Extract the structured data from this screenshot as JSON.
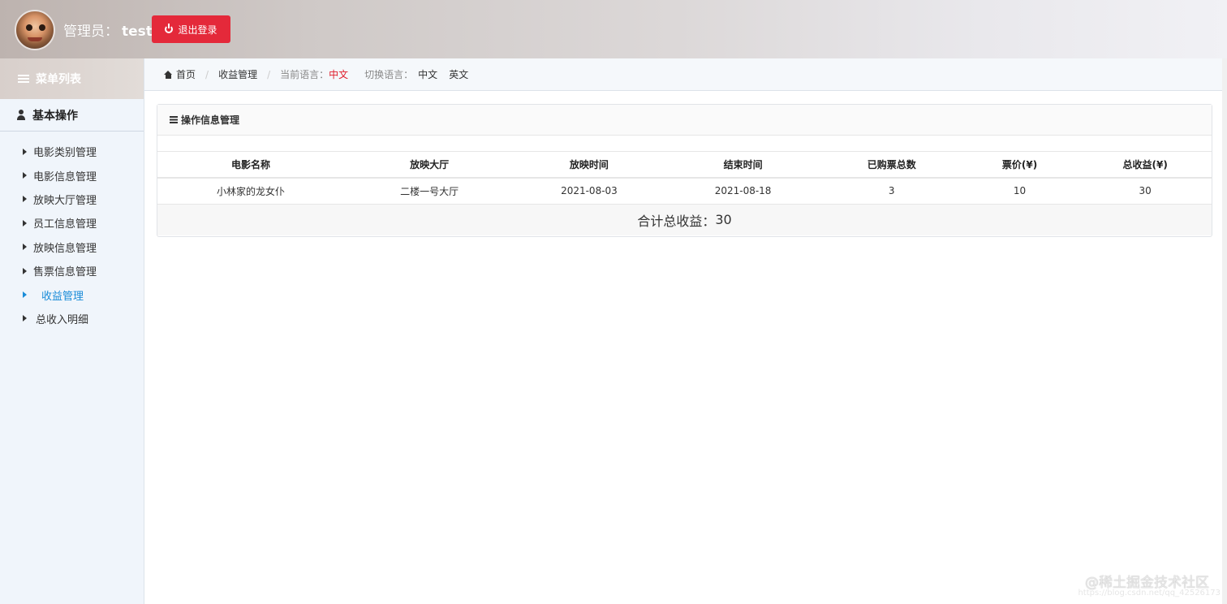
{
  "header": {
    "admin_label": "管理员：",
    "admin_name": "test",
    "logout_label": "退出登录"
  },
  "sidebar": {
    "menu_title": "菜单列表",
    "section_title": "基本操作",
    "items": [
      {
        "label": "电影类别管理"
      },
      {
        "label": "电影信息管理"
      },
      {
        "label": "放映大厅管理"
      },
      {
        "label": "员工信息管理"
      },
      {
        "label": "放映信息管理"
      },
      {
        "label": "售票信息管理"
      },
      {
        "label": "收益管理",
        "active": true
      },
      {
        "label": "总收入明细"
      }
    ]
  },
  "breadcrumb": {
    "home": "首页",
    "current": "收益管理",
    "current_lang_label": "当前语言：",
    "current_lang": "中文",
    "switch_lang_label": "切换语言：",
    "lang_zh": "中文",
    "lang_en": "英文"
  },
  "panel": {
    "title": "操作信息管理",
    "columns": [
      "电影名称",
      "放映大厅",
      "放映时间",
      "结束时间",
      "已购票总数",
      "票价(¥)",
      "总收益(¥)"
    ],
    "rows": [
      [
        "小林家的龙女仆",
        "二楼一号大厅",
        "2021-08-03",
        "2021-08-18",
        "3",
        "10",
        "30"
      ]
    ],
    "total_label": "合计总收益：",
    "total_value": "30"
  },
  "watermark": {
    "text": "@稀土掘金技术社区",
    "url": "https://blog.csdn.net/qq_42526173"
  },
  "colors": {
    "logout_bg": "#e4293a",
    "active_link": "#1a8cd8",
    "current_lang": "#e01c2b"
  }
}
